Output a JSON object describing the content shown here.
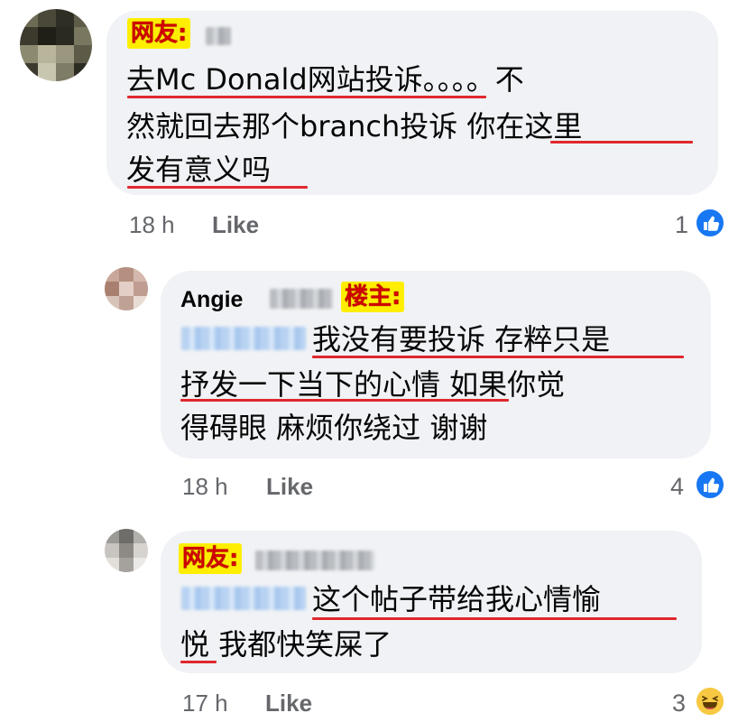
{
  "comment1": {
    "tag": "网友:",
    "lines": [
      "去Mc Donald网站投诉。。。。不",
      "然就回去那个branch投诉 你在这里",
      "发有意义吗"
    ],
    "time": "18 h",
    "like_label": "Like",
    "reaction_count": "1",
    "reaction": "thumbs-up-icon"
  },
  "comment2": {
    "author": "Angie",
    "tag": "楼主:",
    "lines": [
      "我没有要投诉 存粹只是",
      "抒发一下当下的心情 如果你觉",
      "得碍眼 麻烦你绕过 谢谢"
    ],
    "time": "18 h",
    "like_label": "Like",
    "reaction_count": "4",
    "reaction": "thumbs-up-icon"
  },
  "comment3": {
    "tag": "网友:",
    "lines": [
      "这个帖子带给我心情愉",
      "悦 我都快笑屎了"
    ],
    "time": "17 h",
    "like_label": "Like",
    "reaction_count": "3",
    "reaction": "haha-emoji-icon"
  },
  "colors": {
    "bubble": "#f0f2f5",
    "underline": "#e0282e",
    "tag_bg": "#ffee00",
    "tag_text": "#d10000",
    "like_blue": "#1877f2",
    "meta": "#65676b"
  }
}
